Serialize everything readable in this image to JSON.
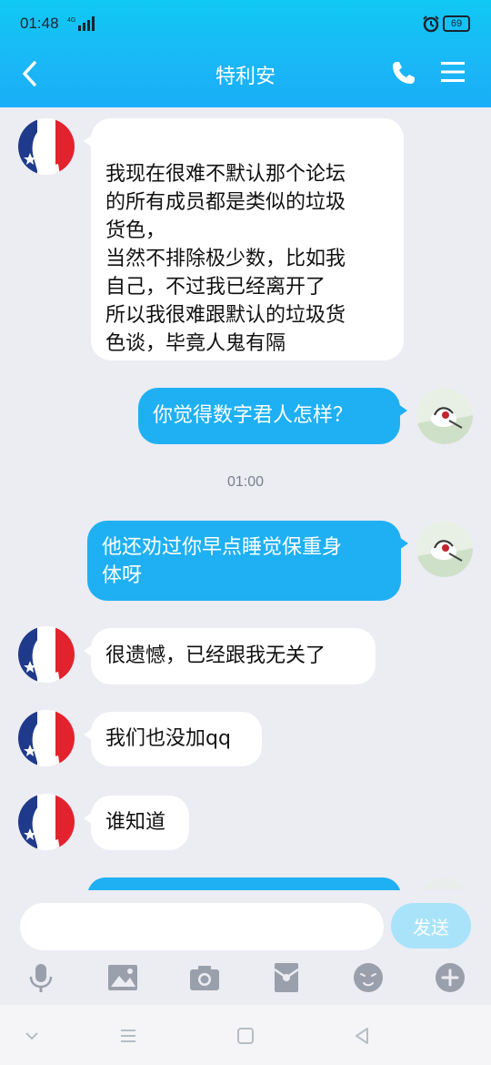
{
  "status": {
    "time": "01:48",
    "network": "4G",
    "battery": "69"
  },
  "header": {
    "title": "特利安"
  },
  "messages": [
    {
      "side": "left",
      "lines": [
        "我现在很难不默认那个论坛",
        "的所有成员都是类似的垃圾",
        "货色，",
        "当然不排除极少数，比如我",
        "自己，不过我已经离开了",
        "所以我很难跟默认的垃圾货",
        "色谈，毕竟人鬼有隔"
      ]
    },
    {
      "side": "right",
      "text": "你觉得数字君人怎样？"
    },
    {
      "side": "right",
      "lines": [
        "他还劝过你早点睡觉保重身",
        "体呀"
      ]
    },
    {
      "side": "left",
      "text": "很遗憾，已经跟我无关了"
    },
    {
      "side": "left",
      "text": "我们也没加qq"
    },
    {
      "side": "left",
      "text": "谁知道"
    }
  ],
  "timestamp": "01:00",
  "input": {
    "value": "",
    "placeholder": ""
  },
  "send_label": "发送",
  "toolbar_icons": [
    "microphone-icon",
    "image-icon",
    "camera-icon",
    "red-packet-icon",
    "emoji-icon",
    "plus-icon"
  ],
  "colors": {
    "accent": "#1fb0f3",
    "header": "#16bdf5",
    "background": "#ececf3"
  }
}
